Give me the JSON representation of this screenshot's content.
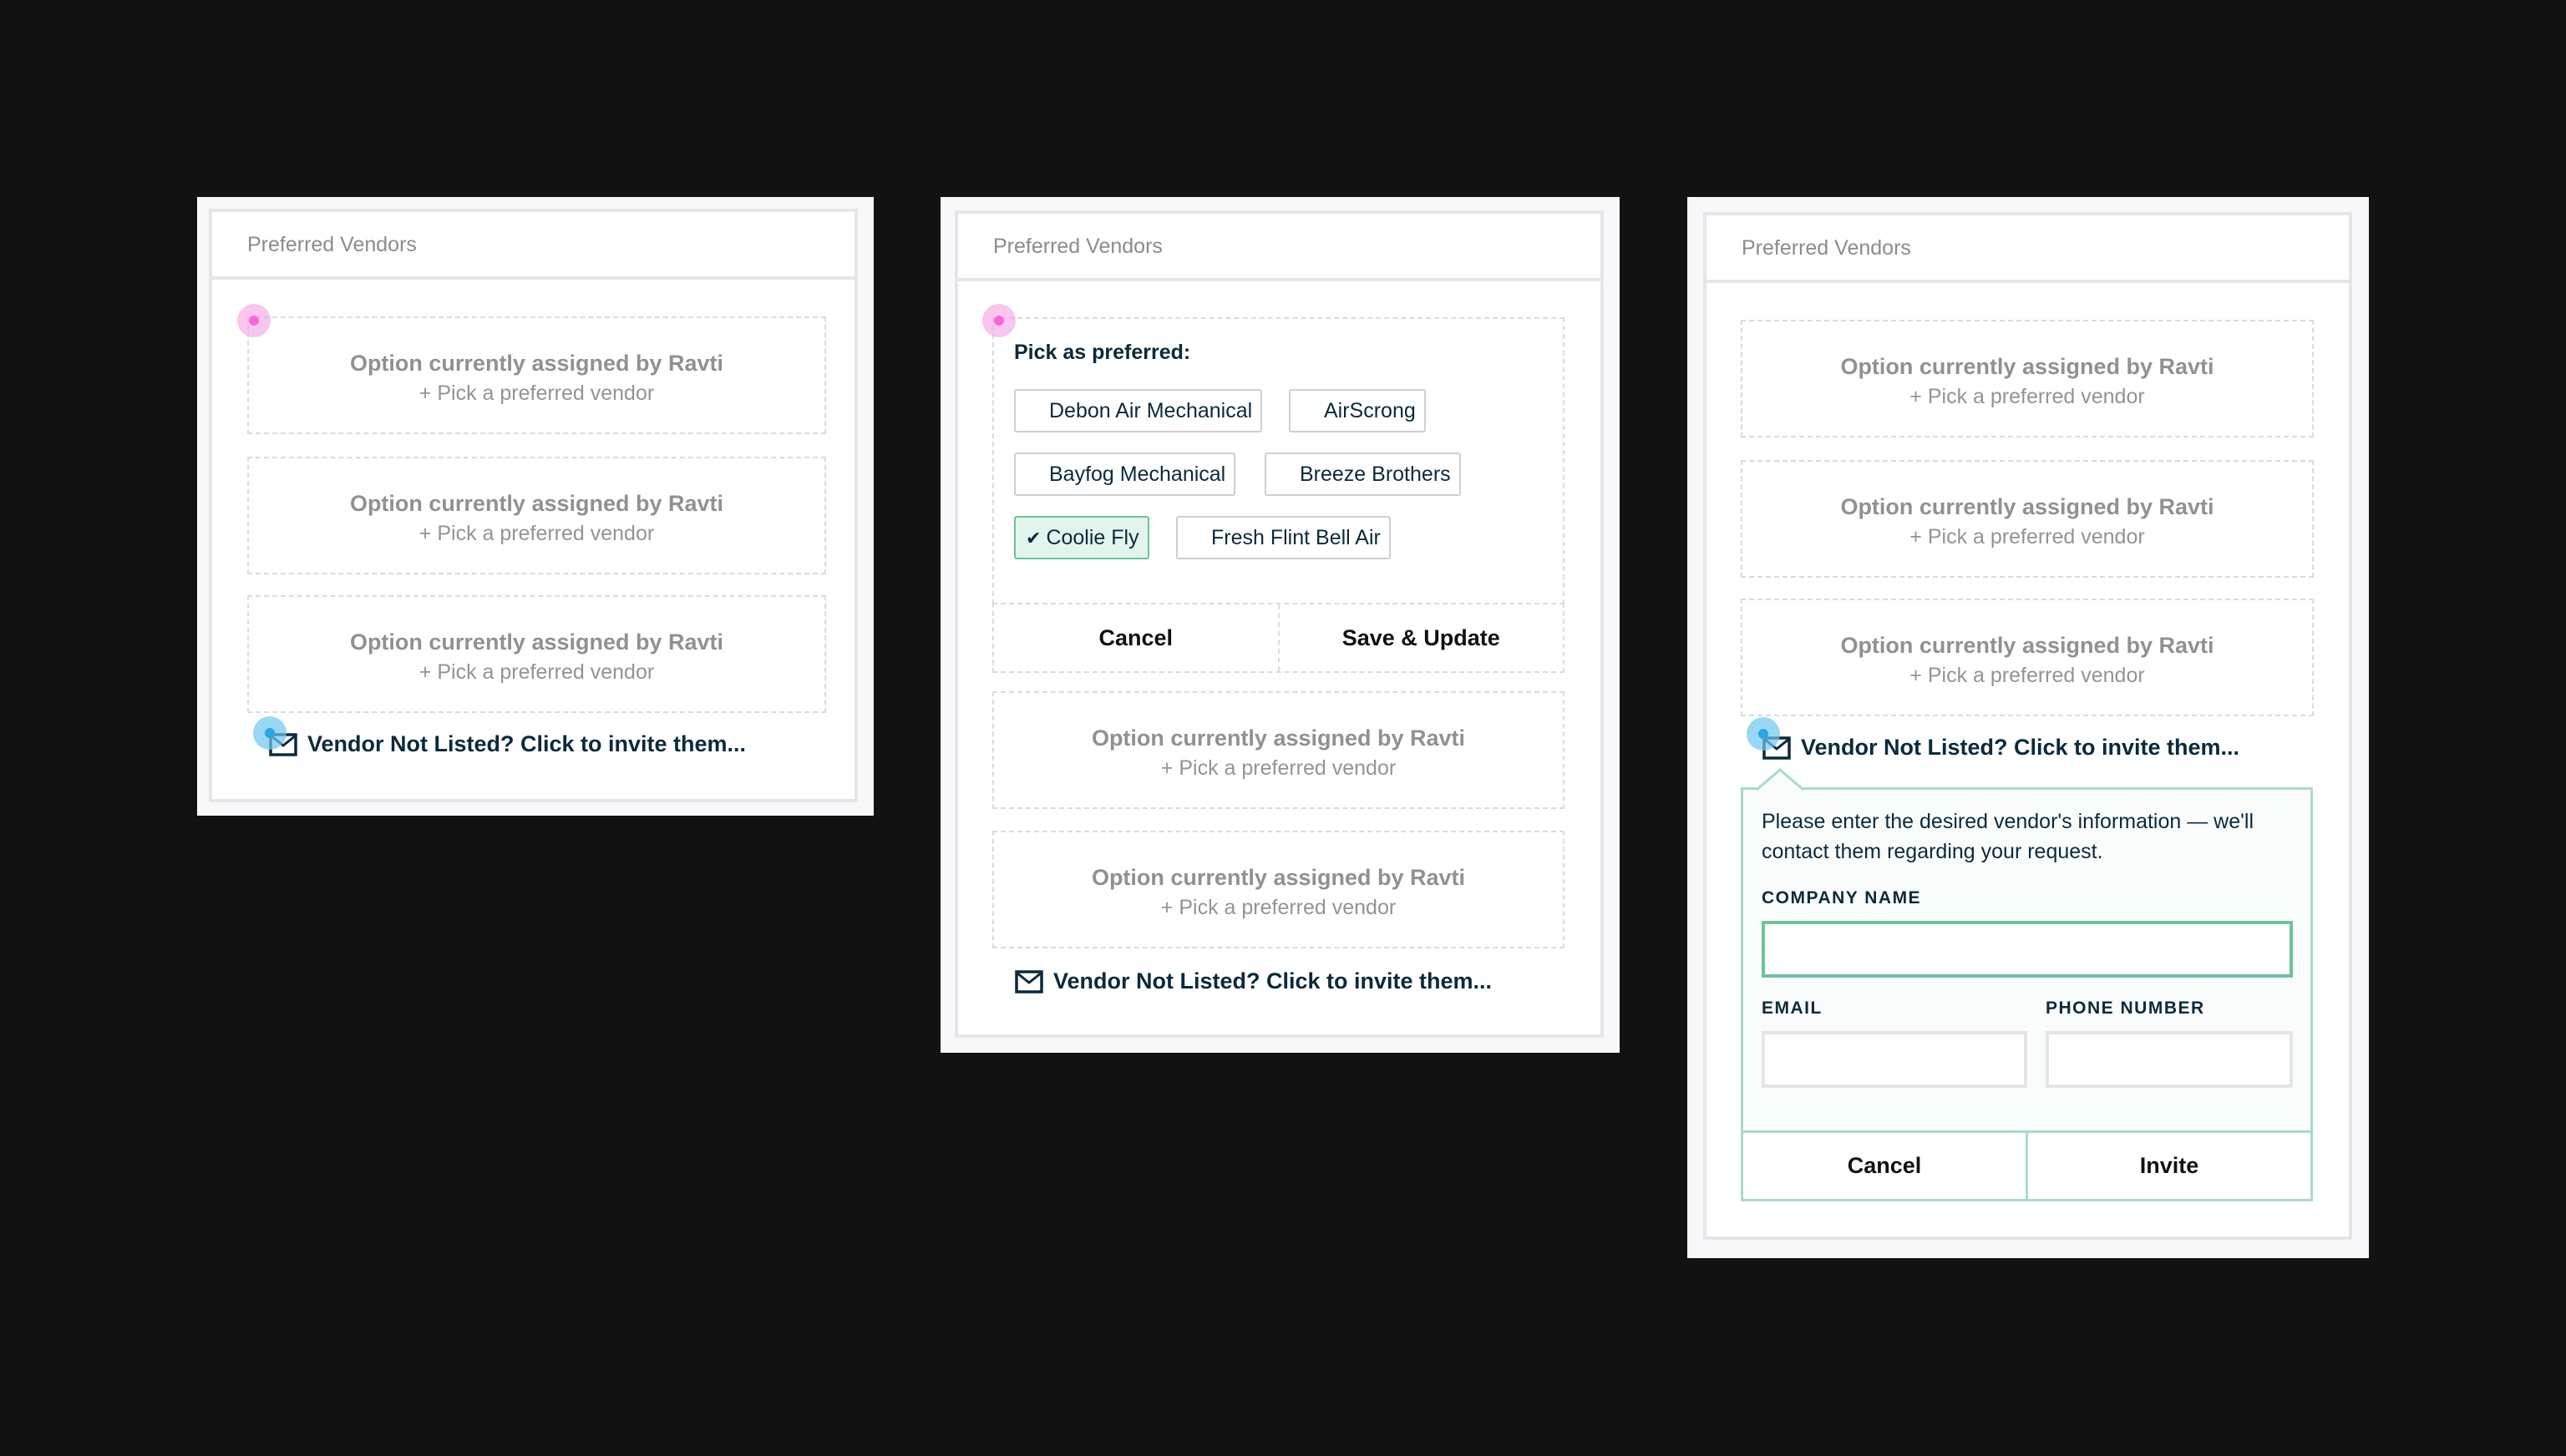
{
  "panels": [
    {
      "title": "Preferred Vendors",
      "slots": [
        {
          "assigned": "Option currently assigned by Ravti",
          "action": "+ Pick a preferred vendor"
        },
        {
          "assigned": "Option currently assigned by Ravti",
          "action": "+ Pick a preferred vendor"
        },
        {
          "assigned": "Option currently assigned by Ravti",
          "action": "+ Pick a preferred vendor"
        }
      ],
      "invite_link": "Vendor Not Listed? Click to invite them..."
    },
    {
      "title": "Preferred Vendors",
      "picker": {
        "title": "Pick as preferred:",
        "vendors": [
          {
            "name": "Debon Air Mechanical",
            "selected": false
          },
          {
            "name": "AirScrong",
            "selected": false
          },
          {
            "name": "Bayfog Mechanical",
            "selected": false
          },
          {
            "name": "Breeze Brothers",
            "selected": false
          },
          {
            "name": "Coolie Fly",
            "selected": true,
            "check_glyph": "✔"
          },
          {
            "name": "Fresh Flint Bell Air",
            "selected": false
          }
        ],
        "cancel_label": "Cancel",
        "save_label": "Save & Update"
      },
      "slots": [
        {
          "assigned": "Option currently assigned by Ravti",
          "action": "+ Pick a preferred vendor"
        },
        {
          "assigned": "Option currently assigned by Ravti",
          "action": "+ Pick a preferred vendor"
        }
      ],
      "invite_link": "Vendor Not Listed? Click to invite them..."
    },
    {
      "title": "Preferred Vendors",
      "slots": [
        {
          "assigned": "Option currently assigned by Ravti",
          "action": "+ Pick a preferred vendor"
        },
        {
          "assigned": "Option currently assigned by Ravti",
          "action": "+ Pick a preferred vendor"
        },
        {
          "assigned": "Option currently assigned by Ravti",
          "action": "+ Pick a preferred vendor"
        }
      ],
      "invite_link": "Vendor Not Listed? Click to invite them...",
      "invite_form": {
        "description": "Please enter the desired vendor's information — we'll contact them regarding your request.",
        "company_label": "COMPANY NAME",
        "company_value": "",
        "email_label": "EMAIL",
        "email_value": "",
        "phone_label": "PHONE NUMBER",
        "phone_value": "",
        "cancel_label": "Cancel",
        "invite_label": "Invite"
      }
    }
  ],
  "colors": {
    "background": "#121212",
    "text_dark": "#0b2a3c",
    "muted_text": "#8f9194",
    "accent_green": "#6cc49a",
    "selected_fill": "#e3f4ec",
    "touch_pink": "#f26ad8",
    "touch_blue": "#2aa6e0"
  }
}
